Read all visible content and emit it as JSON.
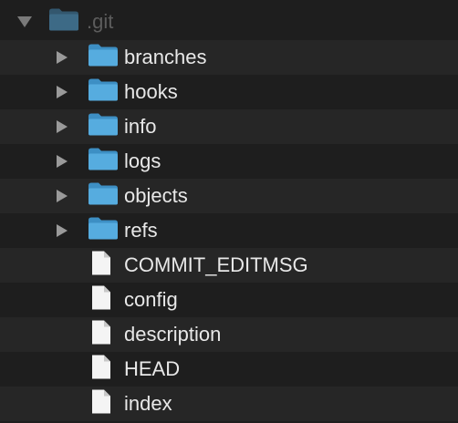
{
  "root": {
    "label": ".git",
    "expanded": true,
    "icon": "folder-icon"
  },
  "items": [
    {
      "label": "branches",
      "kind": "folder",
      "icon": "folder-icon"
    },
    {
      "label": "hooks",
      "kind": "folder",
      "icon": "folder-icon"
    },
    {
      "label": "info",
      "kind": "folder",
      "icon": "folder-icon"
    },
    {
      "label": "logs",
      "kind": "folder",
      "icon": "folder-icon"
    },
    {
      "label": "objects",
      "kind": "folder",
      "icon": "folder-icon"
    },
    {
      "label": "refs",
      "kind": "folder",
      "icon": "folder-icon"
    },
    {
      "label": "COMMIT_EDITMSG",
      "kind": "file",
      "icon": "file-icon"
    },
    {
      "label": "config",
      "kind": "file",
      "icon": "file-icon"
    },
    {
      "label": "description",
      "kind": "file",
      "icon": "file-icon"
    },
    {
      "label": "HEAD",
      "kind": "file",
      "icon": "file-icon"
    },
    {
      "label": "index",
      "kind": "file",
      "icon": "file-icon"
    }
  ],
  "colors": {
    "folder": "#4fa3d8",
    "folder_dim": "#33576e",
    "file": "#f4f4f4"
  }
}
